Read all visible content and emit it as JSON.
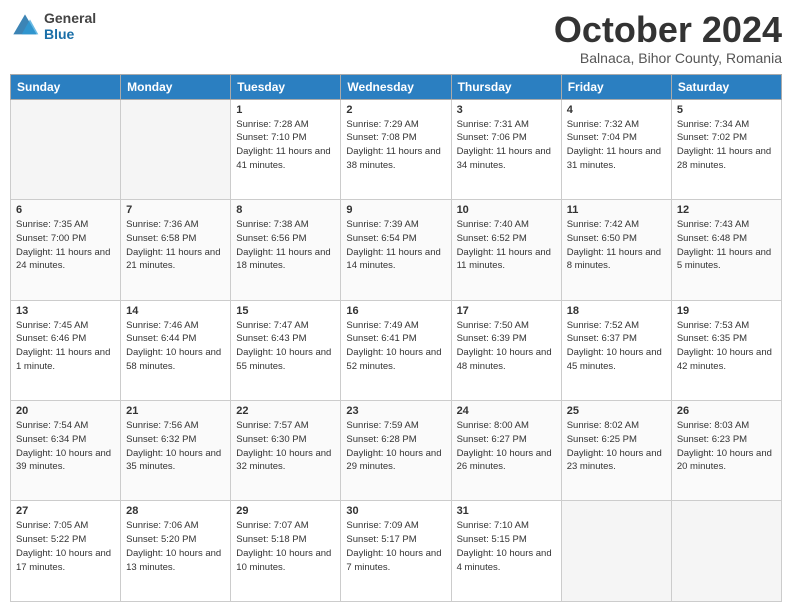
{
  "header": {
    "logo_general": "General",
    "logo_blue": "Blue",
    "month": "October 2024",
    "location": "Balnaca, Bihor County, Romania"
  },
  "days_of_week": [
    "Sunday",
    "Monday",
    "Tuesday",
    "Wednesday",
    "Thursday",
    "Friday",
    "Saturday"
  ],
  "weeks": [
    [
      {
        "day": "",
        "empty": true
      },
      {
        "day": "",
        "empty": true
      },
      {
        "day": "1",
        "sunrise": "Sunrise: 7:28 AM",
        "sunset": "Sunset: 7:10 PM",
        "daylight": "Daylight: 11 hours and 41 minutes."
      },
      {
        "day": "2",
        "sunrise": "Sunrise: 7:29 AM",
        "sunset": "Sunset: 7:08 PM",
        "daylight": "Daylight: 11 hours and 38 minutes."
      },
      {
        "day": "3",
        "sunrise": "Sunrise: 7:31 AM",
        "sunset": "Sunset: 7:06 PM",
        "daylight": "Daylight: 11 hours and 34 minutes."
      },
      {
        "day": "4",
        "sunrise": "Sunrise: 7:32 AM",
        "sunset": "Sunset: 7:04 PM",
        "daylight": "Daylight: 11 hours and 31 minutes."
      },
      {
        "day": "5",
        "sunrise": "Sunrise: 7:34 AM",
        "sunset": "Sunset: 7:02 PM",
        "daylight": "Daylight: 11 hours and 28 minutes."
      }
    ],
    [
      {
        "day": "6",
        "sunrise": "Sunrise: 7:35 AM",
        "sunset": "Sunset: 7:00 PM",
        "daylight": "Daylight: 11 hours and 24 minutes."
      },
      {
        "day": "7",
        "sunrise": "Sunrise: 7:36 AM",
        "sunset": "Sunset: 6:58 PM",
        "daylight": "Daylight: 11 hours and 21 minutes."
      },
      {
        "day": "8",
        "sunrise": "Sunrise: 7:38 AM",
        "sunset": "Sunset: 6:56 PM",
        "daylight": "Daylight: 11 hours and 18 minutes."
      },
      {
        "day": "9",
        "sunrise": "Sunrise: 7:39 AM",
        "sunset": "Sunset: 6:54 PM",
        "daylight": "Daylight: 11 hours and 14 minutes."
      },
      {
        "day": "10",
        "sunrise": "Sunrise: 7:40 AM",
        "sunset": "Sunset: 6:52 PM",
        "daylight": "Daylight: 11 hours and 11 minutes."
      },
      {
        "day": "11",
        "sunrise": "Sunrise: 7:42 AM",
        "sunset": "Sunset: 6:50 PM",
        "daylight": "Daylight: 11 hours and 8 minutes."
      },
      {
        "day": "12",
        "sunrise": "Sunrise: 7:43 AM",
        "sunset": "Sunset: 6:48 PM",
        "daylight": "Daylight: 11 hours and 5 minutes."
      }
    ],
    [
      {
        "day": "13",
        "sunrise": "Sunrise: 7:45 AM",
        "sunset": "Sunset: 6:46 PM",
        "daylight": "Daylight: 11 hours and 1 minute."
      },
      {
        "day": "14",
        "sunrise": "Sunrise: 7:46 AM",
        "sunset": "Sunset: 6:44 PM",
        "daylight": "Daylight: 10 hours and 58 minutes."
      },
      {
        "day": "15",
        "sunrise": "Sunrise: 7:47 AM",
        "sunset": "Sunset: 6:43 PM",
        "daylight": "Daylight: 10 hours and 55 minutes."
      },
      {
        "day": "16",
        "sunrise": "Sunrise: 7:49 AM",
        "sunset": "Sunset: 6:41 PM",
        "daylight": "Daylight: 10 hours and 52 minutes."
      },
      {
        "day": "17",
        "sunrise": "Sunrise: 7:50 AM",
        "sunset": "Sunset: 6:39 PM",
        "daylight": "Daylight: 10 hours and 48 minutes."
      },
      {
        "day": "18",
        "sunrise": "Sunrise: 7:52 AM",
        "sunset": "Sunset: 6:37 PM",
        "daylight": "Daylight: 10 hours and 45 minutes."
      },
      {
        "day": "19",
        "sunrise": "Sunrise: 7:53 AM",
        "sunset": "Sunset: 6:35 PM",
        "daylight": "Daylight: 10 hours and 42 minutes."
      }
    ],
    [
      {
        "day": "20",
        "sunrise": "Sunrise: 7:54 AM",
        "sunset": "Sunset: 6:34 PM",
        "daylight": "Daylight: 10 hours and 39 minutes."
      },
      {
        "day": "21",
        "sunrise": "Sunrise: 7:56 AM",
        "sunset": "Sunset: 6:32 PM",
        "daylight": "Daylight: 10 hours and 35 minutes."
      },
      {
        "day": "22",
        "sunrise": "Sunrise: 7:57 AM",
        "sunset": "Sunset: 6:30 PM",
        "daylight": "Daylight: 10 hours and 32 minutes."
      },
      {
        "day": "23",
        "sunrise": "Sunrise: 7:59 AM",
        "sunset": "Sunset: 6:28 PM",
        "daylight": "Daylight: 10 hours and 29 minutes."
      },
      {
        "day": "24",
        "sunrise": "Sunrise: 8:00 AM",
        "sunset": "Sunset: 6:27 PM",
        "daylight": "Daylight: 10 hours and 26 minutes."
      },
      {
        "day": "25",
        "sunrise": "Sunrise: 8:02 AM",
        "sunset": "Sunset: 6:25 PM",
        "daylight": "Daylight: 10 hours and 23 minutes."
      },
      {
        "day": "26",
        "sunrise": "Sunrise: 8:03 AM",
        "sunset": "Sunset: 6:23 PM",
        "daylight": "Daylight: 10 hours and 20 minutes."
      }
    ],
    [
      {
        "day": "27",
        "sunrise": "Sunrise: 7:05 AM",
        "sunset": "Sunset: 5:22 PM",
        "daylight": "Daylight: 10 hours and 17 minutes."
      },
      {
        "day": "28",
        "sunrise": "Sunrise: 7:06 AM",
        "sunset": "Sunset: 5:20 PM",
        "daylight": "Daylight: 10 hours and 13 minutes."
      },
      {
        "day": "29",
        "sunrise": "Sunrise: 7:07 AM",
        "sunset": "Sunset: 5:18 PM",
        "daylight": "Daylight: 10 hours and 10 minutes."
      },
      {
        "day": "30",
        "sunrise": "Sunrise: 7:09 AM",
        "sunset": "Sunset: 5:17 PM",
        "daylight": "Daylight: 10 hours and 7 minutes."
      },
      {
        "day": "31",
        "sunrise": "Sunrise: 7:10 AM",
        "sunset": "Sunset: 5:15 PM",
        "daylight": "Daylight: 10 hours and 4 minutes."
      },
      {
        "day": "",
        "empty": true
      },
      {
        "day": "",
        "empty": true
      }
    ]
  ]
}
